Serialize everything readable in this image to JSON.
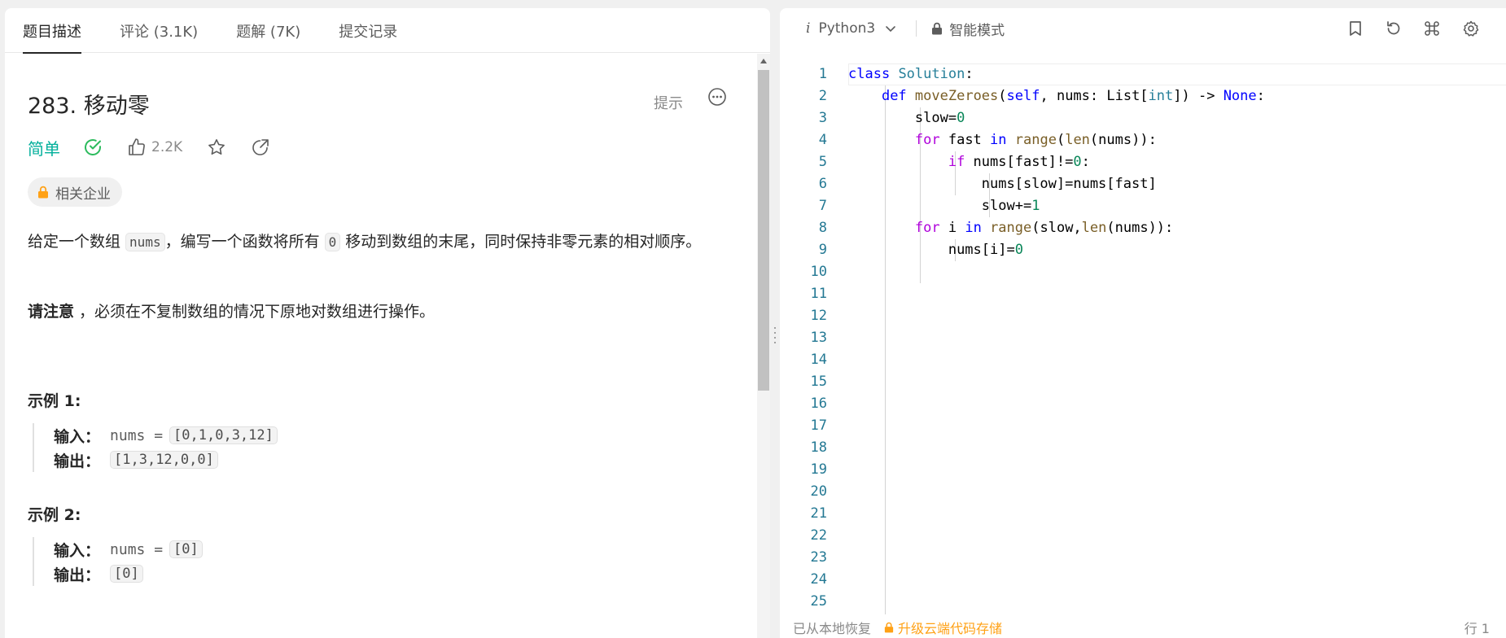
{
  "tabs": [
    {
      "label": "题目描述"
    },
    {
      "label": "评论 (3.1K)"
    },
    {
      "label": "题解 (7K)"
    },
    {
      "label": "提交记录"
    }
  ],
  "problem": {
    "title": "283. 移动零",
    "hint_label": "提示",
    "difficulty": "简单",
    "like_count": "2.2K",
    "company_tag": "相关企业",
    "desc_part1": "给定一个数组 ",
    "desc_code1": "nums",
    "desc_part2": "，编写一个函数将所有 ",
    "desc_code2": "0",
    "desc_part3": " 移动到数组的末尾，同时保持非零元素的相对顺序。",
    "note_bold": "请注意",
    "note_rest": " ，必须在不复制数组的情况下原地对数组进行操作。"
  },
  "examples": [
    {
      "title": "示例 1:",
      "input_label": "输入：",
      "input_prefix": "nums = ",
      "input_value": "[0,1,0,3,12]",
      "output_label": "输出：",
      "output_value": "[1,3,12,0,0]"
    },
    {
      "title": "示例 2:",
      "input_label": "输入：",
      "input_prefix": "nums = ",
      "input_value": "[0]",
      "output_label": "输出：",
      "output_value": "[0]"
    }
  ],
  "editor": {
    "language": "Python3",
    "mode": "智能模式",
    "line_numbers": [
      "1",
      "2",
      "3",
      "4",
      "5",
      "6",
      "7",
      "8",
      "9",
      "10",
      "11",
      "12",
      "13",
      "14",
      "15",
      "16",
      "17",
      "18",
      "19",
      "20",
      "21",
      "22",
      "23",
      "24",
      "25"
    ],
    "code": {
      "l1_kw": "class",
      "l1_cls": "Solution",
      "l1_rest": ":",
      "l2_kw": "def",
      "l2_fn": "moveZeroes",
      "l2_a": "(",
      "l2_self": "self",
      "l2_b": ", nums: List[",
      "l2_int": "int",
      "l2_c": "]) -> ",
      "l2_none": "None",
      "l2_d": ":",
      "l3_a": "slow=",
      "l3_num": "0",
      "l4_for": "for",
      "l4_a": " fast ",
      "l4_in": "in",
      "l4_range": "range",
      "l4_b": "(",
      "l4_len": "len",
      "l4_c": "(nums)):",
      "l5_if": "if",
      "l5_a": " nums[fast]!=",
      "l5_num": "0",
      "l5_b": ":",
      "l6": "nums[slow]=nums[fast]",
      "l7_a": "slow+=",
      "l7_num": "1",
      "l8_for": "for",
      "l8_a": " i ",
      "l8_in": "in",
      "l8_range": "range",
      "l8_b": "(slow,",
      "l8_len": "len",
      "l8_c": "(nums)):",
      "l9_a": "nums[i]=",
      "l9_num": "0"
    }
  },
  "status": {
    "saved": "已从本地恢复",
    "upgrade": "升级云端代码存储",
    "position": "行 1"
  },
  "colors": {
    "accent_easy": "#00af9b",
    "upgrade": "#ffa116",
    "line_number": "#237893"
  }
}
